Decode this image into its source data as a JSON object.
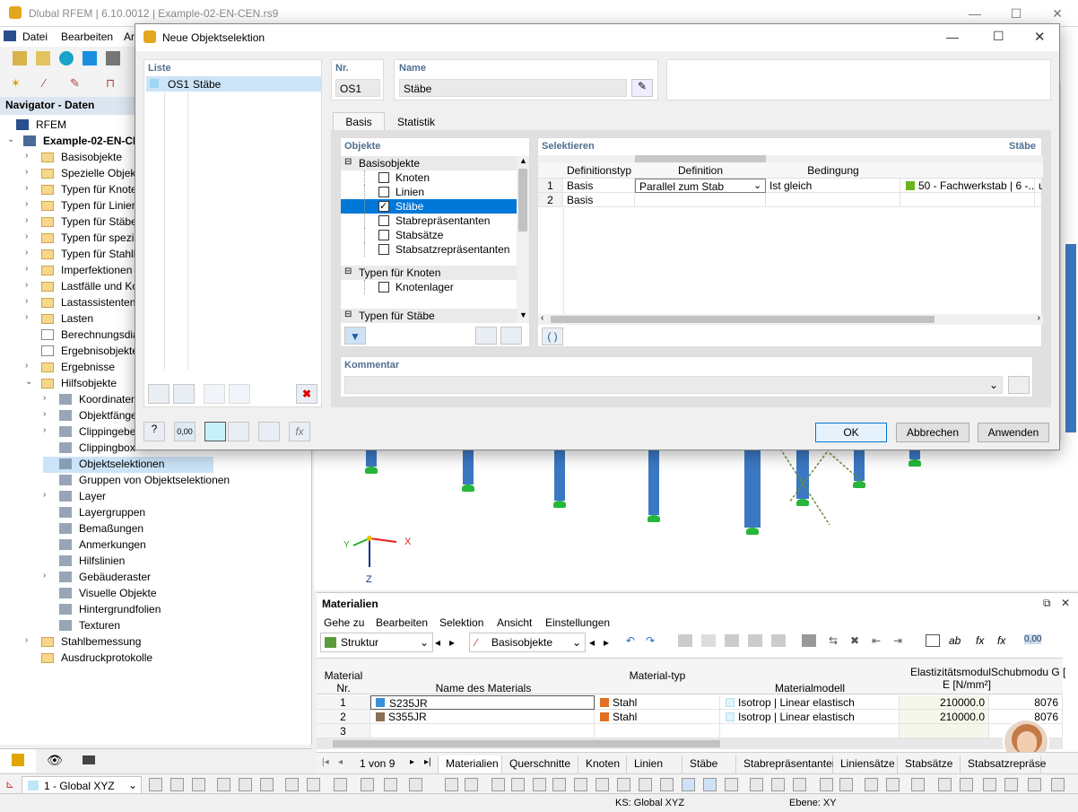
{
  "app": {
    "title": "Dlubal RFEM | 6.10.0012 | Example-02-EN-CEN.rs9"
  },
  "menu": [
    "Datei",
    "Bearbeiten",
    "Ar"
  ],
  "navigator": {
    "title": "Navigator - Daten",
    "root": "RFEM",
    "project": "Example-02-EN-CEN",
    "items": [
      "Basisobjekte",
      "Spezielle Objekt",
      "Typen für Knote",
      "Typen für Linien",
      "Typen für Stäbe",
      "Typen für spezie",
      "Typen für Stahlb",
      "Imperfektionen",
      "Lastfälle und Ko",
      "Lastassistenten",
      "Lasten",
      "Berechnungsdia",
      "Ergebnisobjekte",
      "Ergebnisse",
      "Hilfsobjekte"
    ],
    "sub_items": [
      "Koordinaten",
      "Objektfänge",
      "Clippingebe",
      "Clippingbox",
      "Objektselektionen",
      "Gruppen von Objektselektionen",
      "Layer",
      "Layergruppen",
      "Bemaßungen",
      "Anmerkungen",
      "Hilfslinien",
      "Gebäuderaster",
      "Visuelle Objekte",
      "Hintergrundfolien",
      "Texturen"
    ],
    "tail_items": [
      "Stahlbemessung",
      "Ausdruckprotokolle"
    ]
  },
  "dialog": {
    "title": "Neue Objektselektion",
    "list_header": "Liste",
    "list_item_nr": "OS1",
    "list_item_name": "Stäbe",
    "nr_label": "Nr.",
    "nr_value": "OS1",
    "name_label": "Name",
    "name_value": "Stäbe",
    "tabs": [
      "Basis",
      "Statistik"
    ],
    "objects_header": "Objekte",
    "group1": "Basisobjekte",
    "group1_items": [
      "Knoten",
      "Linien",
      "Stäbe",
      "Stabrepräsentanten",
      "Stabsätze",
      "Stabsatzrepräsentanten"
    ],
    "group2": "Typen für Knoten",
    "group2_items": [
      "Knotenlager"
    ],
    "group3": "Typen für Stäbe",
    "select_header": "Selektieren",
    "select_right": "Stäbe",
    "grid_headers": [
      "Definitionstyp",
      "Definition",
      "Bedingung"
    ],
    "rows": [
      {
        "nr": "1",
        "type": "Basis",
        "definition": "Parallel zum Stab",
        "condition": "Ist gleich",
        "value": "50 - Fachwerkstab | 6 -...",
        "extra": "u"
      },
      {
        "nr": "2",
        "type": "Basis",
        "definition": "",
        "condition": "",
        "value": "",
        "extra": ""
      }
    ],
    "paren_btn": "( )",
    "comment_label": "Kommentar",
    "ok": "OK",
    "cancel": "Abbrechen",
    "apply": "Anwenden",
    "zero_label": "0,00",
    "fx_label": "fx"
  },
  "viewport": {
    "axis_x": "X",
    "axis_y": "Y",
    "axis_z": "Z"
  },
  "materials": {
    "title": "Materialien",
    "menu": [
      "Gehe zu",
      "Bearbeiten",
      "Selektion",
      "Ansicht",
      "Einstellungen"
    ],
    "combo1": "Struktur",
    "combo2": "Basisobjekte",
    "zero_label": "0,00",
    "headers": {
      "nr": "Material Nr.",
      "name": "Name des Materials",
      "type": "Material-typ",
      "model": "Materialmodell",
      "e": "Elastizitätsmodul E [N/mm²]",
      "g": "Schubmodu G [N/mm²]"
    },
    "rows": [
      {
        "nr": "1",
        "name": "S235JR",
        "type": "Stahl",
        "model": "Isotrop | Linear elastisch",
        "e": "210000.0",
        "g": "8076",
        "color": "#3b8fd9"
      },
      {
        "nr": "2",
        "name": "S355JR",
        "type": "Stahl",
        "model": "Isotrop | Linear elastisch",
        "e": "210000.0",
        "g": "8076",
        "color": "#8a7056"
      },
      {
        "nr": "3",
        "name": "",
        "type": "",
        "model": "",
        "e": "",
        "g": "",
        "color": ""
      }
    ],
    "pager": "1 von 9",
    "tabs": [
      "Materialien",
      "Querschnitte",
      "Knoten",
      "Linien",
      "Stäbe",
      "Stabrepräsentanten",
      "Liniensätze",
      "Stabsätze",
      "Stabsatzrepräse"
    ]
  },
  "status": {
    "coord": "1 - Global XYZ",
    "ks": "KS: Global XYZ",
    "plane": "Ebene: XY"
  },
  "colors": {
    "accent": "#3b78c2",
    "support": "#25b63a",
    "selected": "#cce4f7"
  }
}
